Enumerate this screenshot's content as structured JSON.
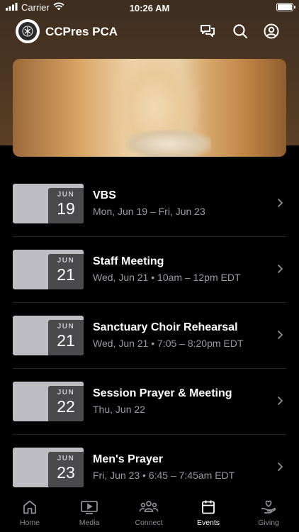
{
  "status": {
    "carrier": "Carrier",
    "time": "10:26 AM"
  },
  "header": {
    "title": "CCPres PCA"
  },
  "events": [
    {
      "month": "JUN",
      "day": "19",
      "title": "VBS",
      "subtitle": "Mon, Jun 19 – Fri, Jun 23"
    },
    {
      "month": "JUN",
      "day": "21",
      "title": "Staff Meeting",
      "subtitle": "Wed, Jun 21 • 10am – 12pm EDT"
    },
    {
      "month": "JUN",
      "day": "21",
      "title": "Sanctuary Choir Rehearsal",
      "subtitle": "Wed, Jun 21 • 7:05 – 8:20pm EDT"
    },
    {
      "month": "JUN",
      "day": "22",
      "title": "Session Prayer & Meeting",
      "subtitle": "Thu, Jun 22"
    },
    {
      "month": "JUN",
      "day": "23",
      "title": "Men's Prayer",
      "subtitle": "Fri, Jun 23 • 6:45 – 7:45am EDT"
    }
  ],
  "tabs": [
    {
      "label": "Home",
      "icon": "home-icon"
    },
    {
      "label": "Media",
      "icon": "media-icon"
    },
    {
      "label": "Connect",
      "icon": "connect-icon"
    },
    {
      "label": "Events",
      "icon": "calendar-icon"
    },
    {
      "label": "Giving",
      "icon": "giving-icon"
    }
  ],
  "active_tab": "Events"
}
